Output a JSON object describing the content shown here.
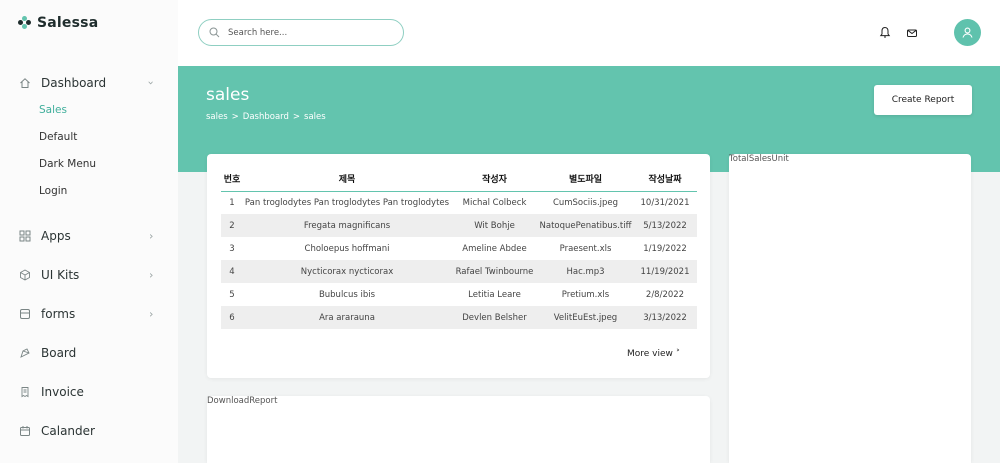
{
  "brand": {
    "name": "Salessa"
  },
  "sidebar": {
    "dashboard": {
      "label": "Dashboard",
      "subitems": [
        "Sales",
        "Default",
        "Dark Menu",
        "Login"
      ]
    },
    "items": [
      {
        "label": "Apps",
        "icon": "grid-icon"
      },
      {
        "label": "UI Kits",
        "icon": "cube-icon"
      },
      {
        "label": "forms",
        "icon": "form-icon"
      },
      {
        "label": "Board",
        "icon": "board-icon"
      },
      {
        "label": "Invoice",
        "icon": "invoice-icon"
      },
      {
        "label": "Calander",
        "icon": "calendar-icon"
      }
    ]
  },
  "topbar": {
    "search_placeholder": "Search here..."
  },
  "page": {
    "title": "sales",
    "breadcrumb": [
      "sales",
      ">",
      "Dashboard",
      ">",
      "sales"
    ],
    "create_button": "Create Report"
  },
  "table": {
    "headers": [
      "번호",
      "제목",
      "작성자",
      "별도파일",
      "작성날짜"
    ],
    "rows": [
      [
        "1",
        "Pan troglodytes Pan troglodytes Pan troglodytes",
        "Michal Colbeck",
        "CumSociis.jpeg",
        "10/31/2021"
      ],
      [
        "2",
        "Fregata magnificans",
        "Wit Bohje",
        "NatoquePenatibus.tiff",
        "5/13/2022"
      ],
      [
        "3",
        "Choloepus hoffmani",
        "Ameline Abdee",
        "Praesent.xls",
        "1/19/2022"
      ],
      [
        "4",
        "Nycticorax nycticorax",
        "Rafael Twinbourne",
        "Hac.mp3",
        "11/19/2021"
      ],
      [
        "5",
        "Bubulcus ibis",
        "Letitia Leare",
        "Pretium.xls",
        "2/8/2022"
      ],
      [
        "6",
        "Ara ararauna",
        "Devlen Belsher",
        "VelitEuEst.jpeg",
        "3/13/2022"
      ]
    ],
    "more_label": "More view ˃"
  },
  "cards": {
    "right_label": "TotalSalesUnit",
    "bottom_label": "DownloadReport"
  },
  "colors": {
    "accent": "#63c4ae",
    "active": "#3fae9b"
  }
}
